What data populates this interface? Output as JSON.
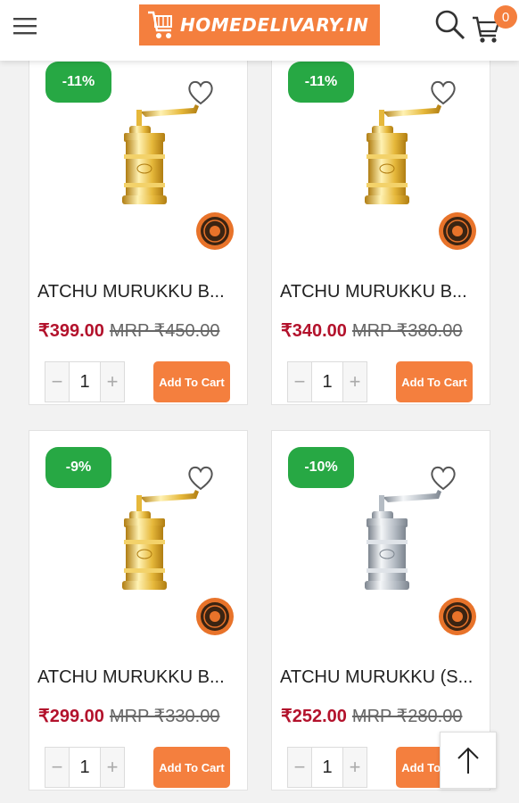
{
  "header": {
    "logo_text": "HOMEDELIVARY.IN",
    "cart_count": "0",
    "brand_color": "#f47f3e"
  },
  "icons": {
    "menu": "hamburger-icon",
    "search": "search-icon",
    "cart": "cart-icon",
    "wishlist": "heart-icon",
    "scroll_top": "arrow-up-icon"
  },
  "products": [
    {
      "discount": "-11%",
      "title": "ATCHU MURUKKU B...",
      "price": "₹399.00",
      "mrp": "MRP ₹450.00",
      "qty": "1",
      "add_label": "Add To Cart",
      "material": "brass"
    },
    {
      "discount": "-11%",
      "title": "ATCHU MURUKKU B...",
      "price": "₹340.00",
      "mrp": "MRP ₹380.00",
      "qty": "1",
      "add_label": "Add To Cart",
      "material": "brass"
    },
    {
      "discount": "-9%",
      "title": "ATCHU MURUKKU B...",
      "price": "₹299.00",
      "mrp": "MRP ₹330.00",
      "qty": "1",
      "add_label": "Add To Cart",
      "material": "brass"
    },
    {
      "discount": "-10%",
      "title": "ATCHU MURUKKU (S...",
      "price": "₹252.00",
      "mrp": "MRP ₹280.00",
      "qty": "1",
      "add_label": "Add To Cart",
      "material": "steel"
    }
  ],
  "qty_controls": {
    "minus": "−",
    "plus": "+"
  }
}
